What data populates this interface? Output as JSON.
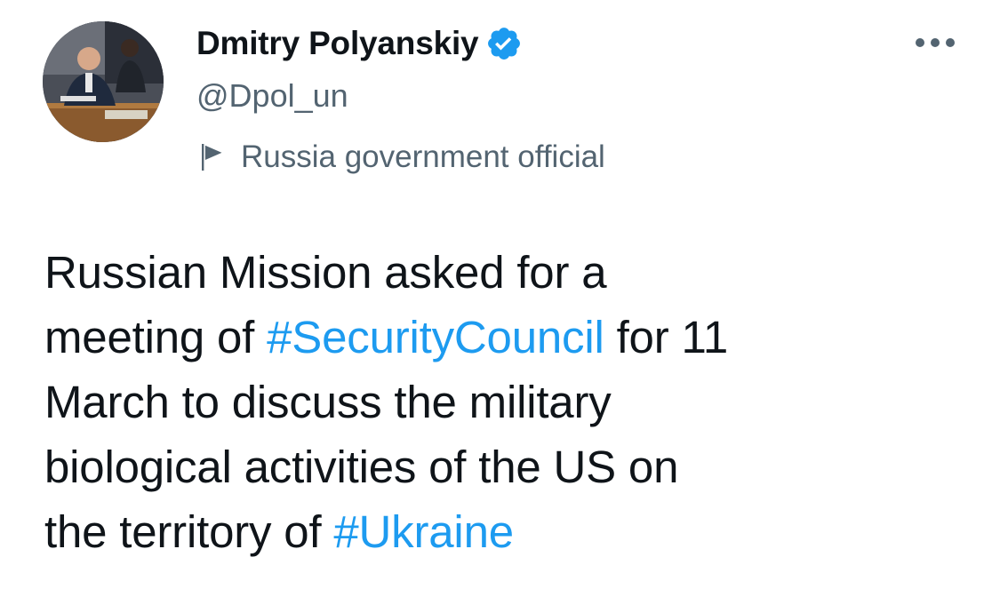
{
  "author": {
    "display_name": "Dmitry Polyanskiy",
    "handle": "@Dpol_un",
    "verified": true,
    "label": "Russia government official",
    "avatar_icon": "profile-photo"
  },
  "tweet": {
    "line1": "Russian Mission asked for a",
    "line2_before": "meeting of ",
    "hashtag_security": "#SecurityCouncil",
    "line2_after": " for 11",
    "line3": "March to discuss the military",
    "line4": "biological activities of the US on",
    "line5_before": "the territory of ",
    "hashtag_ukraine": "#Ukraine"
  },
  "icons": {
    "verified": "verified-badge-icon",
    "label_flag": "flag-icon",
    "more": "more-options-icon"
  },
  "colors": {
    "text_primary": "#0f1419",
    "text_secondary": "#536471",
    "accent": "#1d9bf0"
  }
}
